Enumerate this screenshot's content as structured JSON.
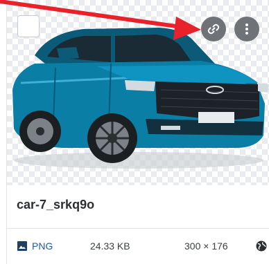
{
  "asset": {
    "name": "car-7_srkq9o",
    "format": "PNG",
    "size": "24.33 KB",
    "dimensions": "300 × 176"
  },
  "icons": {
    "link": "link-icon",
    "more": "more-vertical-icon",
    "format": "image-icon",
    "access": "globe-icon"
  },
  "colors": {
    "car_body": "#0b7ea6",
    "annotation_arrow": "#e8212a",
    "format_link": "#1f5c99",
    "icon_button": "#6f7377"
  }
}
